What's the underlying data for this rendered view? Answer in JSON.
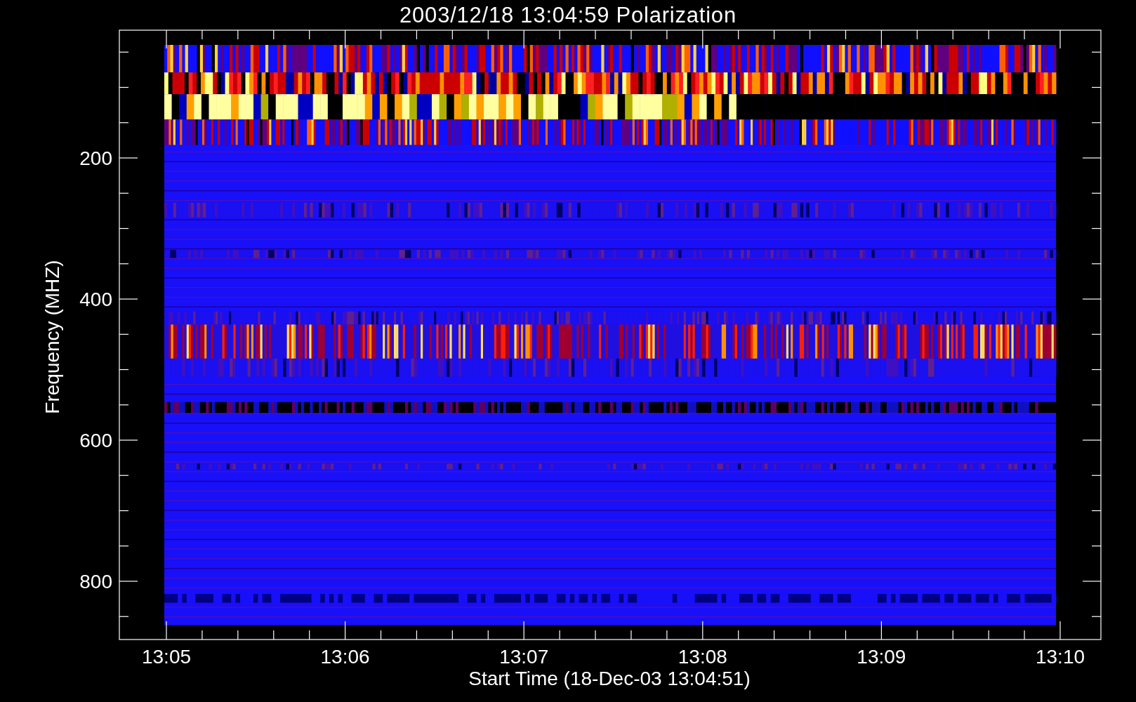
{
  "title": "2003/12/18 13:04:59 Polarization",
  "y_axis": {
    "label": "Frequency (MHZ)",
    "tick_labels": [
      "200",
      "400",
      "600",
      "800"
    ]
  },
  "x_axis": {
    "label": "Start Time (18-Dec-03 13:04:51)",
    "tick_labels": [
      "13:05",
      "13:06",
      "13:07",
      "13:08",
      "13:09",
      "13:10"
    ]
  }
}
